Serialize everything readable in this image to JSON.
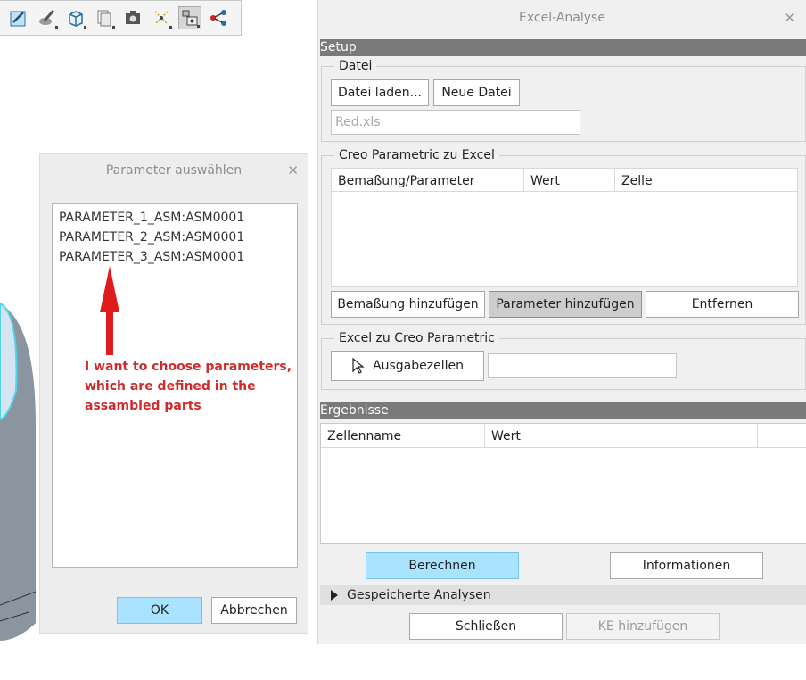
{
  "toolbar": {
    "icons": [
      "edit-icon",
      "brush-icon",
      "cube-icon",
      "doc-stack-icon",
      "camera-icon",
      "sparkle-icon",
      "view-icon",
      "tree-icon"
    ]
  },
  "param_dialog": {
    "title": "Parameter auswählen",
    "items": [
      "PARAMETER_1_ASM:ASM0001",
      "PARAMETER_2_ASM:ASM0001",
      "PARAMETER_3_ASM:ASM0001"
    ],
    "ok_label": "OK",
    "cancel_label": "Abbrechen"
  },
  "annotation": {
    "lines": [
      "I want to choose parameters,",
      "which are defined in the",
      "assambled parts"
    ],
    "color": "#d12a2a"
  },
  "excel_dialog": {
    "title": "Excel-Analyse",
    "setup_header": "Setup",
    "file_group": {
      "label": "Datei",
      "load_label": "Datei laden...",
      "new_label": "Neue Datei",
      "file_value": "Red.xls"
    },
    "creo_to_excel": {
      "label": "Creo Parametric zu Excel",
      "columns": [
        "Bemaßung/Parameter",
        "Wert",
        "Zelle"
      ],
      "add_dim_label": "Bemaßung hinzufügen",
      "add_param_label": "Parameter hinzufügen",
      "remove_label": "Entfernen"
    },
    "excel_to_creo": {
      "label": "Excel zu Creo Parametric",
      "output_cells_label": "Ausgabezellen",
      "output_value": ""
    },
    "results_header": "Ergebnisse",
    "results_columns": [
      "Zellenname",
      "Wert"
    ],
    "compute_label": "Berechnen",
    "info_label": "Informationen",
    "saved_analyses_label": "Gespeicherte Analysen",
    "close_label": "Schließen",
    "add_feature_label": "KE hinzufügen"
  },
  "colors": {
    "accent": "#a8e4ff",
    "section_header": "#7a7a7a",
    "annotation": "#d12a2a"
  }
}
